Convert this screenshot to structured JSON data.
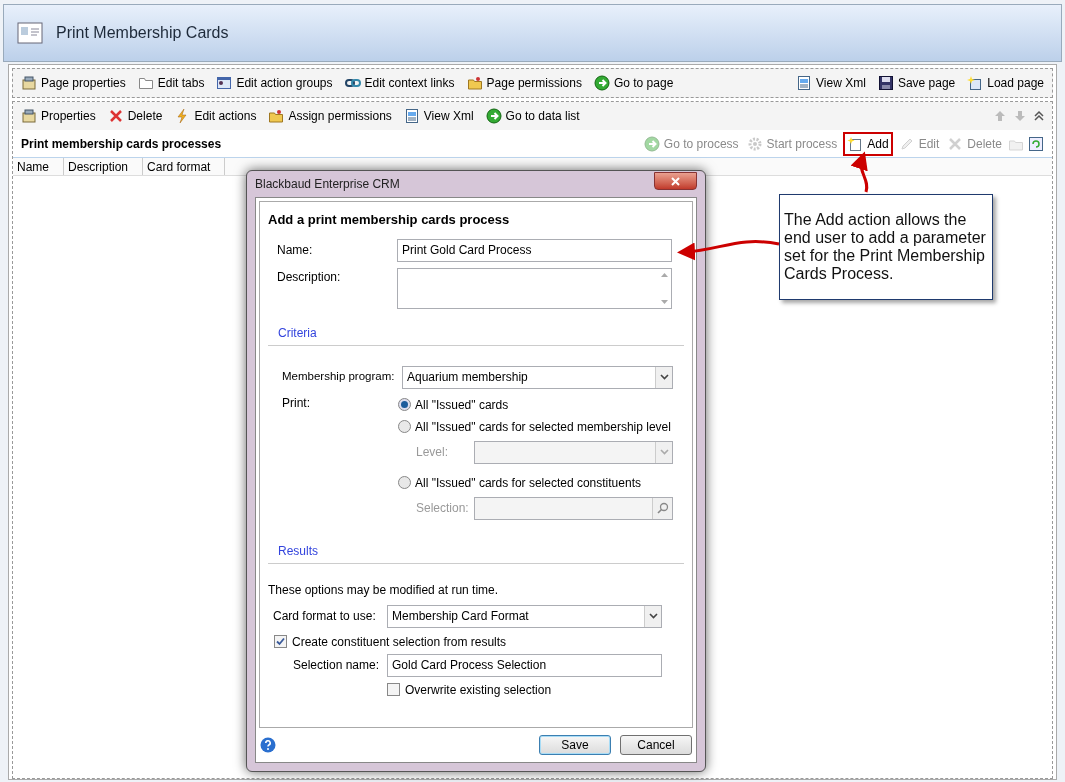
{
  "window": {
    "title": "Print Membership Cards"
  },
  "page_toolbar": {
    "left": [
      {
        "label": "Page properties",
        "kind": "properties"
      },
      {
        "label": "Edit tabs",
        "kind": "tabs"
      },
      {
        "label": "Edit action groups",
        "kind": "groups"
      },
      {
        "label": "Edit context links",
        "kind": "links"
      },
      {
        "label": "Page permissions",
        "kind": "permissions"
      },
      {
        "label": "Go to page",
        "kind": "goto"
      }
    ],
    "right": [
      {
        "label": "View Xml",
        "kind": "xml"
      },
      {
        "label": "Save page",
        "kind": "save"
      },
      {
        "label": "Load page",
        "kind": "load"
      }
    ]
  },
  "section_toolbar": [
    {
      "label": "Properties",
      "kind": "properties"
    },
    {
      "label": "Delete",
      "kind": "delete"
    },
    {
      "label": "Edit actions",
      "kind": "actions"
    },
    {
      "label": "Assign permissions",
      "kind": "permissions"
    },
    {
      "label": "View Xml",
      "kind": "xml"
    },
    {
      "label": "Go to data list",
      "kind": "goto"
    }
  ],
  "list": {
    "title": "Print membership cards processes",
    "actions": [
      {
        "label": "Go to process",
        "kind": "goto",
        "disabled": true,
        "highlighted": false
      },
      {
        "label": "Start process",
        "kind": "gear",
        "disabled": true,
        "highlighted": false
      },
      {
        "label": "Add",
        "kind": "add",
        "disabled": false,
        "highlighted": true
      },
      {
        "label": "Edit",
        "kind": "edit",
        "disabled": true,
        "highlighted": false
      },
      {
        "label": "Delete",
        "kind": "delete",
        "disabled": true,
        "highlighted": false
      }
    ],
    "columns": [
      "Name",
      "Description",
      "Card format"
    ]
  },
  "dialog": {
    "title": "Blackbaud Enterprise CRM",
    "heading": "Add a print membership cards process",
    "name": {
      "label": "Name:",
      "value": "Print Gold Card Process"
    },
    "description": {
      "label": "Description:"
    },
    "criteria": {
      "title": "Criteria",
      "program": {
        "label": "Membership program:",
        "value": "Aquarium membership"
      },
      "print_label": "Print:",
      "print_options": [
        {
          "label": "All \"Issued\" cards",
          "selected": true
        },
        {
          "label": "All \"Issued\" cards for selected membership level",
          "selected": false,
          "subfield": {
            "label": "Level:",
            "kind": "dropdown",
            "disabled": true
          }
        },
        {
          "label": "All \"Issued\" cards for selected constituents",
          "selected": false,
          "subfield": {
            "label": "Selection:",
            "kind": "search",
            "disabled": true
          }
        }
      ]
    },
    "results": {
      "title": "Results",
      "note": "These options may be modified at run time.",
      "card_format": {
        "label": "Card format to use:",
        "value": "Membership Card Format"
      },
      "create_selection": {
        "label": "Create constituent selection from results",
        "checked": true
      },
      "selection_name": {
        "label": "Selection name:",
        "value": "Gold Card Process Selection"
      },
      "overwrite": {
        "label": "Overwrite existing selection",
        "checked": false
      }
    },
    "buttons": [
      {
        "label": "Save",
        "kind": "default"
      },
      {
        "label": "Cancel",
        "kind": "normal"
      }
    ]
  },
  "callout": {
    "text": "The Add action allows the end user to add a parameter set for the Print Membership Cards Process."
  }
}
